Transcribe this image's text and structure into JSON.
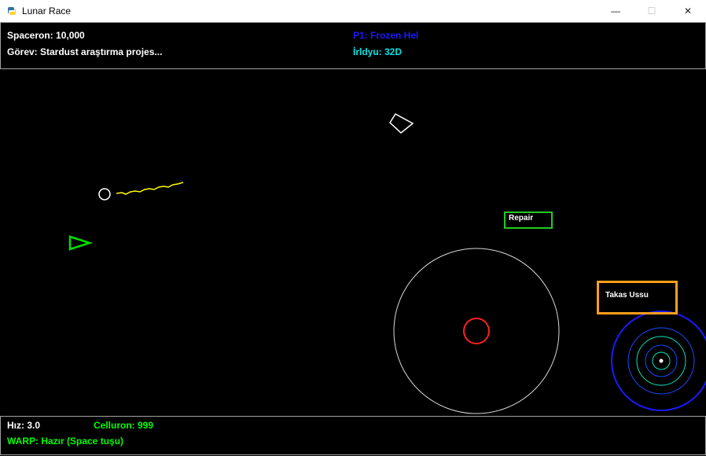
{
  "window": {
    "title": "Lunar Race",
    "icon": "snake-icon",
    "minimize_glyph": "—",
    "maximize_glyph": "☐",
    "close_glyph": "✕"
  },
  "hud_top": {
    "spaceron": "Spaceron: 10,000",
    "mission": "Görev: Stardust araştırma projes...",
    "player": "P1: Frozen Hel",
    "iridyu": "İrldyu: 32D"
  },
  "hud_bottom": {
    "speed": "Hız: 3.0",
    "celluron": "Celluron: 999",
    "warp": "WARP: Hazır (Space tuşu)"
  },
  "map_labels": {
    "repair": "Repair",
    "trade": "Takas Ussu"
  },
  "colors": {
    "player_ship": "#00dd00",
    "laser_trail": "#ffff00",
    "repair_border": "#22cc22",
    "trade_border": "#ff9f1a",
    "planet_core": "#ff2020",
    "station_ring": "#1a1aff",
    "station_inner_ring": "#00e5c0"
  }
}
